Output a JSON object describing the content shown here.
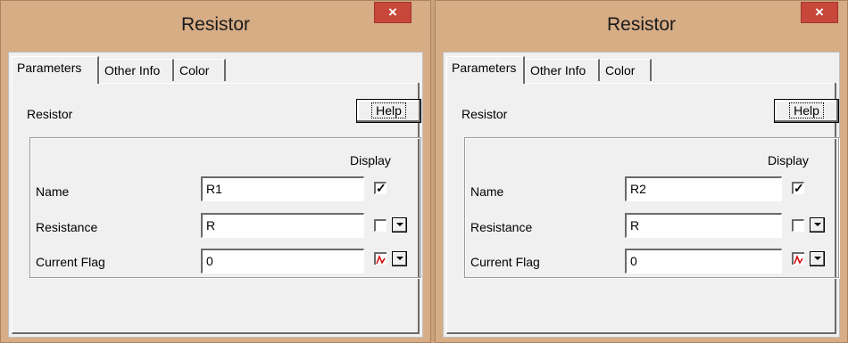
{
  "dialogs": [
    {
      "title": "Resistor",
      "close_glyph": "×",
      "tabs": [
        "Parameters",
        "Other Info",
        "Color"
      ],
      "heading": "Resistor",
      "help_label": "Help",
      "display_label": "Display",
      "rows": [
        {
          "label": "Name",
          "value": "R1",
          "display": "checked"
        },
        {
          "label": "Resistance",
          "value": "R",
          "display": "unchecked"
        },
        {
          "label": "Current Flag",
          "value": "0",
          "display": "flag-icon"
        }
      ]
    },
    {
      "title": "Resistor",
      "close_glyph": "×",
      "tabs": [
        "Parameters",
        "Other Info",
        "Color"
      ],
      "heading": "Resistor",
      "help_label": "Help",
      "display_label": "Display",
      "rows": [
        {
          "label": "Name",
          "value": "R2",
          "display": "checked"
        },
        {
          "label": "Resistance",
          "value": "R",
          "display": "unchecked"
        },
        {
          "label": "Current Flag",
          "value": "0",
          "display": "flag-icon"
        }
      ]
    }
  ],
  "colors": {
    "frame": "#d7ad86",
    "close": "#c7473a",
    "client": "#f0f0f0"
  },
  "icons": {
    "checkmark": "check-icon",
    "flag": "current-flag-icon",
    "dropdown": "chevron-down-icon"
  }
}
